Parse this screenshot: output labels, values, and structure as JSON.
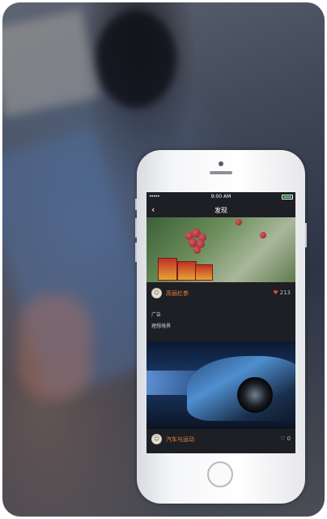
{
  "status": {
    "time": "9:00 AM",
    "signal": "•••••"
  },
  "nav": {
    "back_glyph": "‹",
    "title": "发现"
  },
  "cards": [
    {
      "name": "高丽红参",
      "likes": "213",
      "heart": "♥",
      "ad_label": "广告",
      "ad_subtitle": "理想境界"
    },
    {
      "name": "汽车与运动",
      "likes": "0",
      "heart": "♡"
    }
  ],
  "icons": {
    "avatar": "user-avatar-icon",
    "heart_filled": "heart-filled-icon",
    "heart_outline": "heart-outline-icon",
    "back": "chevron-left-icon"
  },
  "colors": {
    "accent": "#e8823a",
    "screen_bg": "#1d1f24",
    "heart": "#e04c4c"
  }
}
